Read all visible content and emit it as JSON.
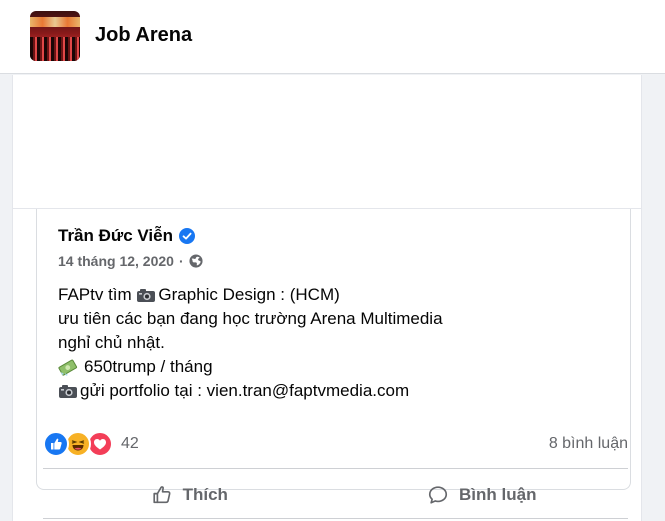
{
  "group": {
    "name": "Job Arena",
    "avatar_icon": "group-cover-photo"
  },
  "shared_post": {
    "author": "Trần Đức Viễn",
    "verified_icon": "verified-badge-icon",
    "date": "14 tháng 12, 2020",
    "separator": "·",
    "privacy_icon": "globe-icon",
    "lines": [
      {
        "prefix_icon": "camera-emoji",
        "text": "FAPtv tìm "
      },
      {
        "text": "ưu tiên các bạn đang học trường Arena Multimedia"
      },
      {
        "text": "nghỉ chủ nhật."
      },
      {
        "prefix_icon": "money-emoji",
        "text": "650trump / tháng"
      },
      {
        "prefix_icon": "camera-emoji",
        "text": "gửi portfolio tại : vien.tran@faptvmedia.com"
      }
    ],
    "line1_suffix": "Graphic Design : (HCM)"
  },
  "reactions": {
    "icons": [
      "like-reaction-icon",
      "haha-reaction-icon",
      "love-reaction-icon"
    ],
    "count": "42",
    "comments": "8 bình luận"
  },
  "actions": {
    "like_label": "Thích",
    "comment_label": "Bình luận"
  },
  "colors": {
    "brand_blue": "#1877f2",
    "secondary_text": "#65676b",
    "haha_yellow": "#f7b125",
    "love_red": "#f33e58"
  }
}
